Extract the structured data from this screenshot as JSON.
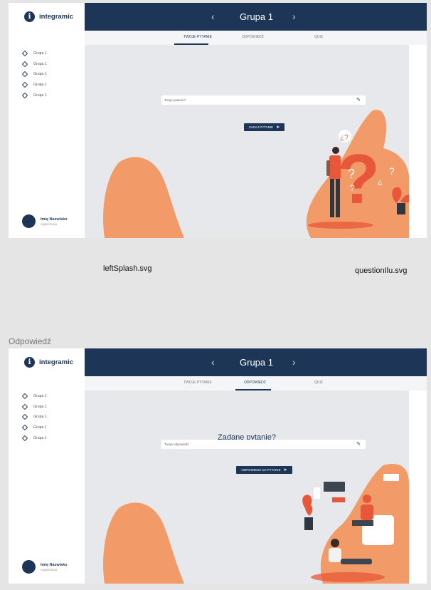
{
  "screen_a": {
    "brand": "integramic",
    "header": {
      "title": "Grupa 1",
      "prev": "‹",
      "next": "›"
    },
    "tabs": [
      "TWOJE PYTANIE",
      "ODPOWIEDŹ",
      "QUIZ"
    ],
    "active_tab": 0,
    "nav": [
      "Grupa 1",
      "Grupa 1",
      "Grupa 1",
      "Grupa 1",
      "Grupa 1"
    ],
    "user": {
      "name": "Imię Nazwisko",
      "org": "organizacja"
    },
    "input_placeholder": "Twoje pytanie?",
    "submit_label": "ZADAJ PYTANIE"
  },
  "captions": {
    "left": "leftSplash.svg",
    "right": "questionIlu.svg"
  },
  "section_b_title": "Odpowiedź",
  "screen_b": {
    "brand": "integramic",
    "header": {
      "title": "Grupa 1",
      "prev": "‹",
      "next": "›"
    },
    "tabs": [
      "TWOJE PYTANIE",
      "ODPOWIEDŹ",
      "QUIZ"
    ],
    "active_tab": 1,
    "nav": [
      "Grupa 1",
      "Grupa 1",
      "Grupa 1",
      "Grupa 1",
      "Grupa 1"
    ],
    "user": {
      "name": "Imię Nazwisko",
      "org": "organizacja"
    },
    "question": "Zadane pytanie?",
    "input_placeholder": "Twoja odpowiedź",
    "submit_label": "ODPOWIEDZ NA PYTANIE"
  },
  "colors": {
    "navy": "#1d3557",
    "orange": "#f29b68",
    "red": "#e8573a",
    "bg": "#e6e8ec"
  }
}
